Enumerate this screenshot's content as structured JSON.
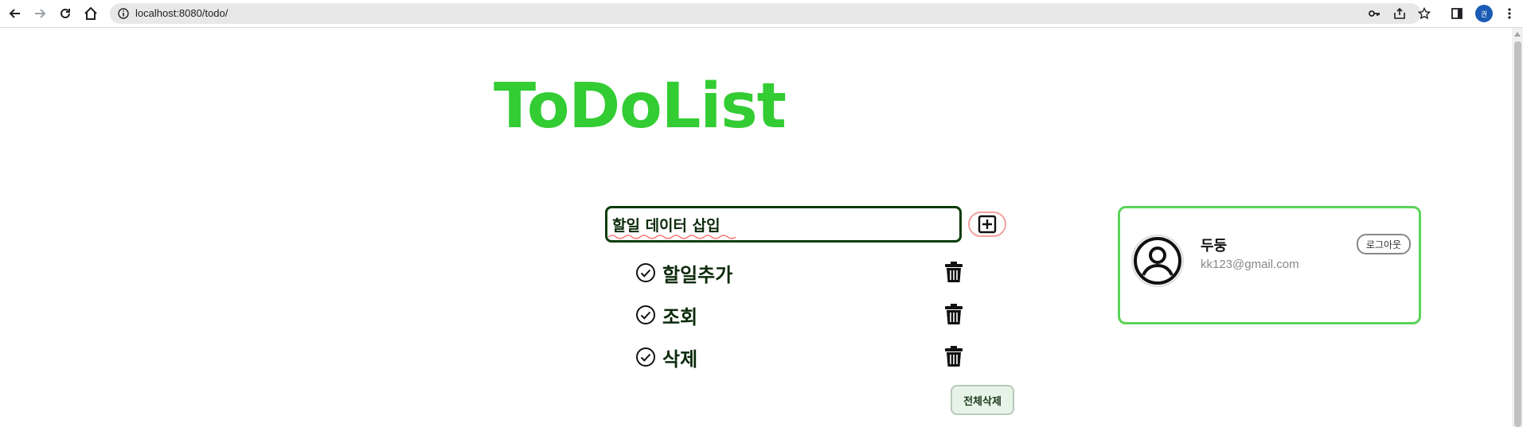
{
  "browser": {
    "url": "localhost:8080/todo/",
    "profile_initial": "권"
  },
  "page": {
    "title": "ToDoList"
  },
  "input": {
    "value": "할일 데이터 삽입"
  },
  "todos": [
    {
      "text": "할일추가"
    },
    {
      "text": "조회"
    },
    {
      "text": "삭제"
    }
  ],
  "actions": {
    "delete_all_label": "전체삭제"
  },
  "profile": {
    "name": "두둥",
    "email": "kk123@gmail.com",
    "logout_label": "로그아웃"
  },
  "colors": {
    "title": "#33cc33",
    "card_border": "#5ad35a",
    "input_border": "#0b3d0b",
    "delete_all_bg": "#e8f3e8"
  }
}
